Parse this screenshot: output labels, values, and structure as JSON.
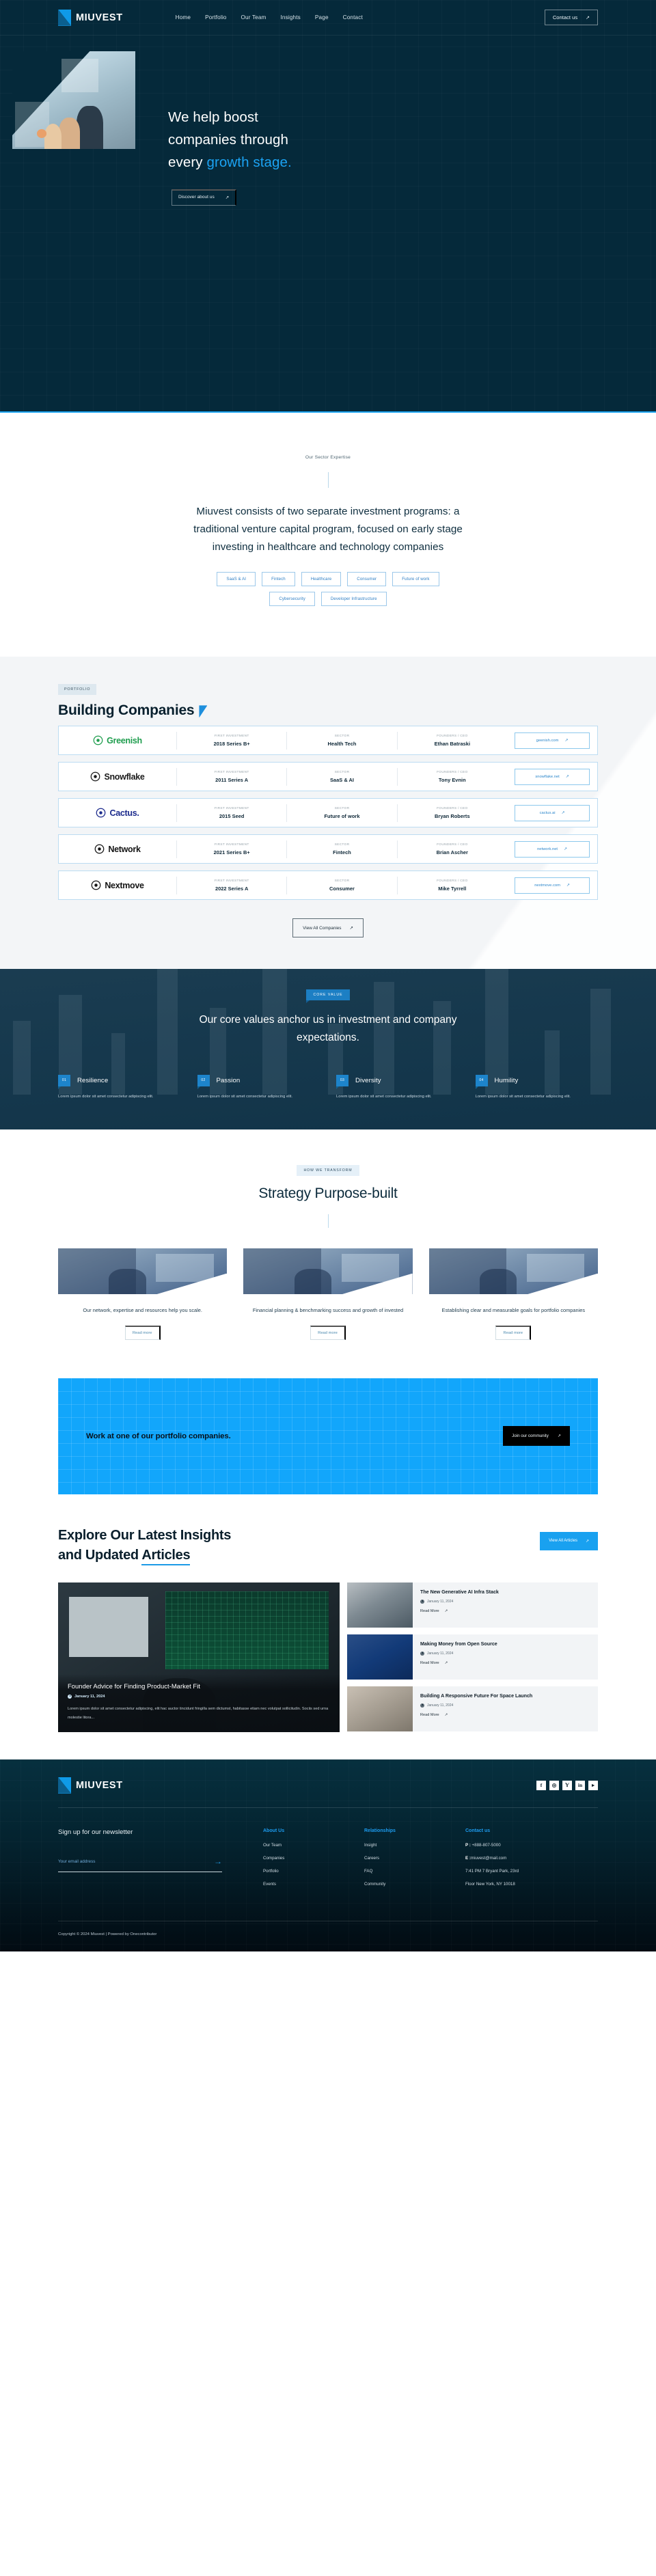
{
  "nav": {
    "brand": "MIUVEST",
    "links": [
      "Home",
      "Portfolio",
      "Our Team",
      "Insights",
      "Page",
      "Contact"
    ],
    "cta": "Contact us",
    "cta_arrow": "↗"
  },
  "hero": {
    "line1": "We help boost",
    "line2": "companies through",
    "line3_pre": "every ",
    "line3_hl": "growth stage.",
    "button": "Discover about us",
    "button_arrow": "↗"
  },
  "sector": {
    "eyebrow": "Our Sector Expertise",
    "heading": "Miuvest consists of two separate investment programs: a traditional venture capital program, focused on early stage investing in healthcare and technology companies",
    "chips_row1": [
      "SaaS & AI",
      "Fintech",
      "Healthcare",
      "Consumer",
      "Future of work"
    ],
    "chips_row2": [
      "Cybersecurity",
      "Developer Infrastructure"
    ]
  },
  "portfolio": {
    "tag": "PORTFOLIO",
    "title": "Building Companies",
    "col_labels": {
      "investment": "FIRST INVESTMENT",
      "sector": "SECTOR",
      "founders": "FOUNDERS / CEO"
    },
    "rows": [
      {
        "company": "Greenish",
        "investment": "2018 Series B+",
        "sector": "Health Tech",
        "founder": "Ethan Batraski",
        "site": "geenish.com",
        "color": "#1f9d4e"
      },
      {
        "company": "Snowflake",
        "investment": "2011 Series A",
        "sector": "SaaS & AI",
        "founder": "Tony Evnin",
        "site": "snowflake.net",
        "color": "#1a1a1a"
      },
      {
        "company": "Cactus.",
        "investment": "2015 Seed",
        "sector": "Future of work",
        "founder": "Bryan Roberts",
        "site": "cactus.ai",
        "color": "#1b2a8c"
      },
      {
        "company": "Network",
        "investment": "2021 Series B+",
        "sector": "Fintech",
        "founder": "Brian Ascher",
        "site": "network.net",
        "color": "#141414"
      },
      {
        "company": "Nextmove",
        "investment": "2022 Series A",
        "sector": "Consumer",
        "founder": "Mike Tyrrell",
        "site": "nextmove.com",
        "color": "#141414"
      }
    ],
    "view_all": "View All Companies",
    "arrow": "↗"
  },
  "core_values": {
    "badge": "CORE VALUE",
    "heading": "Our core values anchor us in investment and company expectations.",
    "items": [
      {
        "num": "01",
        "name": "Resilience",
        "desc": "Lorem ipsum dolor sit amet consectetur adipiscing elit."
      },
      {
        "num": "02",
        "name": "Passion",
        "desc": "Lorem ipsum dolor sit amet consectetur adipiscing elit."
      },
      {
        "num": "03",
        "name": "Diversity",
        "desc": "Lorem ipsum dolor sit amet consectetur adipiscing elit."
      },
      {
        "num": "04",
        "name": "Humility",
        "desc": "Lorem ipsum dolor sit amet consectetur adipiscing elit."
      }
    ]
  },
  "strategy": {
    "badge": "HOW WE TRANSFORM",
    "title": "Strategy Purpose-built",
    "cards": [
      {
        "text": "Our network, expertise and resources help you scale.",
        "link": "Read more"
      },
      {
        "text": "Financial planning & benchmarking success and growth of invested",
        "link": "Read more"
      },
      {
        "text": "Establishing clear and measurable goals for portfolio companies",
        "link": "Read more"
      }
    ]
  },
  "cta_banner": {
    "text": "Work at one of our portfolio companies.",
    "button": "Join our community",
    "arrow": "↗"
  },
  "insights": {
    "title_line1": "Explore Our Latest Insights",
    "title_line2_pre": "and Updated ",
    "title_line2_underlined": "Articles",
    "view_all": "View All Articles",
    "arrow": "↗",
    "feature": {
      "title": "Founder Advice for Finding Product-Market Fit",
      "date": "January 11, 2024",
      "excerpt": "Lorem ipsum dolor sit amet consectetur adipiscing, elit hac auctor tincidunt fringilla sem dictumst, habitasse etiam nec volutpat sollicitudin. Sociis sed urna molestie litora..."
    },
    "cards": [
      {
        "title": "The New Generative AI Infra Stack",
        "date": "January 11, 2024",
        "read": "Read More"
      },
      {
        "title": "Making Money from Open Source",
        "date": "January 11, 2024",
        "read": "Read More"
      },
      {
        "title": "Building A Responsive Future For Space Launch",
        "date": "January 11, 2024",
        "read": "Read More"
      }
    ]
  },
  "footer": {
    "brand": "MIUVEST",
    "socials": [
      "f",
      "◎",
      "𝕐",
      "in",
      "▸"
    ],
    "newsletter_title": "Sign up for our newsletter",
    "email_placeholder": "Your email address",
    "submit_arrow": "→",
    "columns": [
      {
        "heading": "About Us",
        "items": [
          "Our Team",
          "Companies",
          "Portfolio",
          "Events"
        ]
      },
      {
        "heading": "Relationships",
        "items": [
          "Insight",
          "Careers",
          "FAQ",
          "Community"
        ]
      }
    ],
    "contact": {
      "heading": "Contact us",
      "phone_label": "P :",
      "phone": " +888-807-5000",
      "email_label": "E :",
      "email": "miuvest@mail.com",
      "address_line1": "7:41 PM 7 Bryant Park, 23rd",
      "address_line2": "Floor New York, NY 10018"
    },
    "copyright": "Copyright © 2024 Miuvest | Powered by Onecontributor"
  }
}
